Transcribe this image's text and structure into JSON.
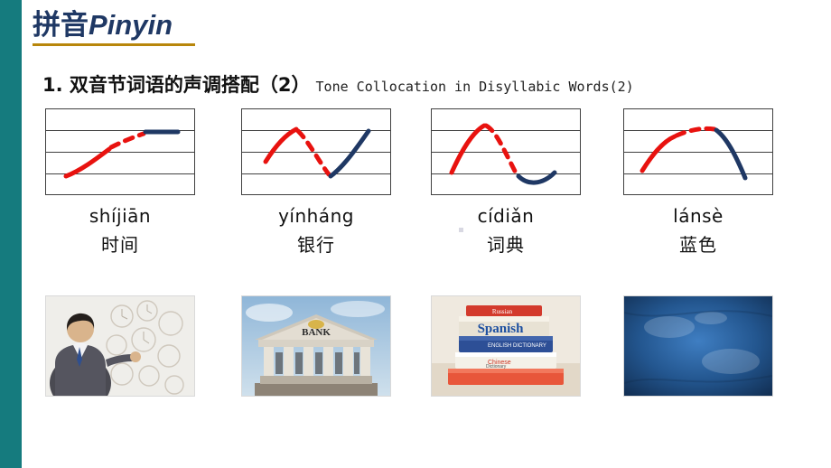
{
  "slide": {
    "title_cn": "拼音",
    "title_en": "Pinyin",
    "heading_cn": "1. 双音节词语的声调搭配（2）",
    "heading_en": "Tone Collocation in Disyllabic Words(2)",
    "accent_color": "#157b7e",
    "title_color": "#1f3864",
    "underline_color": "#b8860b"
  },
  "cards": [
    {
      "pinyin": "shíjiān",
      "hanzi": "时间",
      "tone_pattern": "rising + high-level",
      "photo_alt": "man-with-clocks"
    },
    {
      "pinyin": "yínháng",
      "hanzi": "银行",
      "tone_pattern": "rising + rising",
      "photo_alt": "bank-building"
    },
    {
      "pinyin": "cídiǎn",
      "hanzi": "词典",
      "tone_pattern": "rising + falling-rising",
      "photo_alt": "stack-of-dictionaries"
    },
    {
      "pinyin": "lánsè",
      "hanzi": "蓝色",
      "tone_pattern": "rising + falling",
      "photo_alt": "blue-texture"
    }
  ],
  "colors": {
    "first_syllable_stroke": "#e8120f",
    "second_syllable_stroke": "#1f3864",
    "staff_line": "#404040"
  }
}
